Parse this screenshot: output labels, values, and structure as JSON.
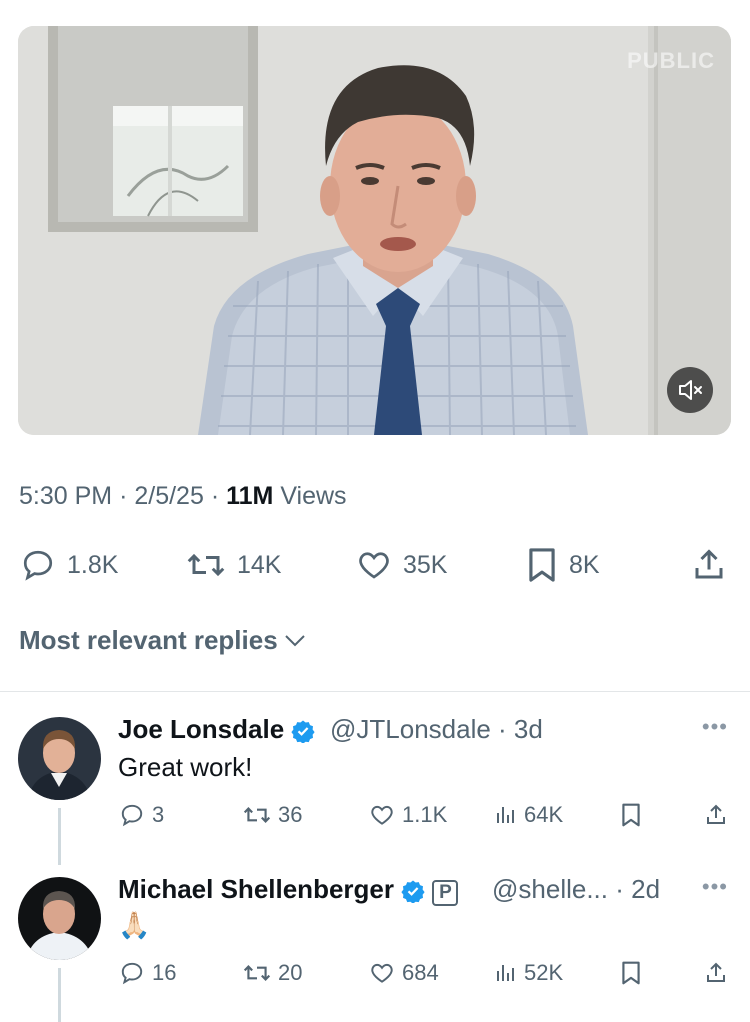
{
  "video": {
    "watermark": "PUBLIC",
    "mute_icon": "speaker-muted-icon"
  },
  "tweet": {
    "time": "5:30 PM",
    "date": "2/5/25",
    "views_count": "11M",
    "views_label": "Views",
    "replies": "1.8K",
    "reposts": "14K",
    "likes": "35K",
    "bookmarks": "8K"
  },
  "sort": {
    "label": "Most relevant replies"
  },
  "replies": [
    {
      "name": "Joe Lonsdale",
      "handle": "@JTLonsdale",
      "time": "3d",
      "text": "Great work!",
      "replies": "3",
      "reposts": "36",
      "likes": "1.1K",
      "views": "64K"
    },
    {
      "name": "Michael Shellenberger",
      "badge": "P",
      "handle": "@shelle...",
      "time": "2d",
      "text": "🙏🏻",
      "replies": "16",
      "reposts": "20",
      "likes": "684",
      "views": "52K"
    }
  ],
  "colors": {
    "accent": "#1d9bf0",
    "muted": "#536471",
    "text": "#0f1419"
  }
}
